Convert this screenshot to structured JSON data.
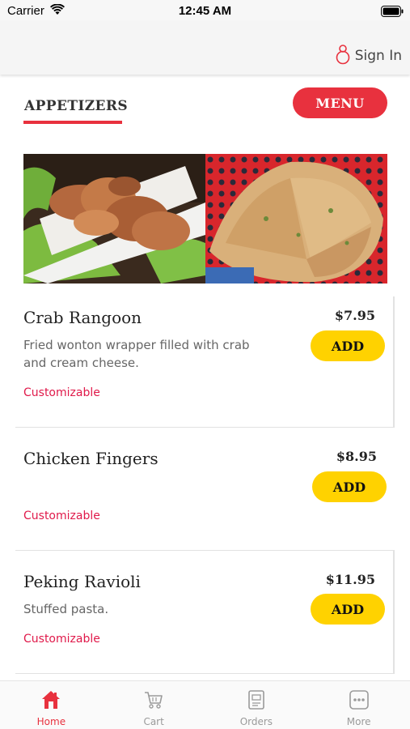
{
  "status_bar": {
    "carrier": "Carrier",
    "time": "12:45 AM"
  },
  "header": {
    "sign_in_label": "Sign In",
    "sign_in_icon": "person-icon"
  },
  "section": {
    "title": "APPETIZERS",
    "menu_button_label": "MENU"
  },
  "colors": {
    "accent": "#e8313e",
    "add_button": "#ffd200",
    "customizable": "#e0194a"
  },
  "items": [
    {
      "name": "Crab Rangoon",
      "description": "Fried wonton wrapper filled with crab and cream cheese.",
      "price": "$7.95",
      "add_label": "ADD",
      "tag": "Customizable"
    },
    {
      "name": "Chicken Fingers",
      "description": "",
      "price": "$8.95",
      "add_label": "ADD",
      "tag": "Customizable"
    },
    {
      "name": "Peking Ravioli",
      "description": "Stuffed pasta.",
      "price": "$11.95",
      "add_label": "ADD",
      "tag": "Customizable"
    }
  ],
  "tabs": [
    {
      "label": "Home",
      "icon": "home-icon",
      "active": true
    },
    {
      "label": "Cart",
      "icon": "cart-icon",
      "active": false
    },
    {
      "label": "Orders",
      "icon": "orders-icon",
      "active": false
    },
    {
      "label": "More",
      "icon": "more-icon",
      "active": false
    }
  ]
}
